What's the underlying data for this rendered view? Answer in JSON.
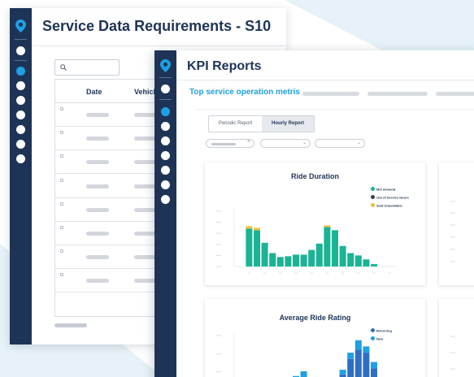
{
  "back_window": {
    "title": "Service Data Requirements - S10",
    "columns": [
      "Date",
      "Vehicle"
    ],
    "row_count": 8
  },
  "front_window": {
    "title": "KPI Reports",
    "section_title": "Top service operation metris",
    "tabs": [
      {
        "label": "Periodic Report",
        "active": false
      },
      {
        "label": "Hourly Report",
        "active": true
      }
    ]
  },
  "sidebar": {
    "active_index": 1
  },
  "charts": {
    "ride_duration": {
      "title": "Ride Duration",
      "legend": [
        {
          "label": "Met demand",
          "color": "#1ab394"
        },
        {
          "label": "Out of Service Hours",
          "color": "#3a4250"
        },
        {
          "label": "Seat Unavailable",
          "color": "#f2c037"
        }
      ]
    },
    "avg_ride_rating": {
      "title": "Average Ride Rating",
      "legend": [
        {
          "label": "Returning",
          "color": "#2e6fc4"
        },
        {
          "label": "New",
          "color": "#1ea0e3"
        }
      ]
    }
  },
  "chart_data": [
    {
      "type": "bar",
      "title": "Ride Duration",
      "categories": [
        "1",
        "2",
        "3",
        "4",
        "5",
        "6",
        "7",
        "8",
        "9",
        "10",
        "11",
        "12",
        "13",
        "14",
        "15",
        "16",
        "17",
        "18",
        "19",
        "20"
      ],
      "series": [
        {
          "name": "Met demand",
          "values": [
            0,
            48,
            46,
            30,
            17,
            12,
            13,
            15,
            15,
            21,
            29,
            50,
            46,
            26,
            17,
            14,
            9,
            3,
            0,
            0
          ]
        },
        {
          "name": "Out of Service Hours",
          "values": [
            0,
            0,
            0,
            0,
            0,
            0,
            0,
            0,
            0,
            0,
            0,
            0,
            0,
            0,
            0,
            0,
            0,
            0,
            0,
            0
          ]
        },
        {
          "name": "Seat Unavailable",
          "values": [
            0,
            3,
            3,
            0,
            0,
            0,
            0,
            0,
            0,
            0,
            0,
            2,
            0,
            0,
            0,
            0,
            0,
            0,
            0,
            0
          ]
        }
      ],
      "stacked": true,
      "ylim": [
        0,
        70
      ]
    },
    {
      "type": "bar",
      "title": "Average Ride Rating",
      "categories": [
        "1",
        "2",
        "3",
        "4",
        "5",
        "6",
        "7",
        "8",
        "9",
        "10",
        "11",
        "12",
        "13",
        "14",
        "15",
        "16",
        "17",
        "18",
        "19",
        "20"
      ],
      "series": [
        {
          "name": "Returning",
          "values": [
            0,
            0,
            0,
            0,
            0,
            0,
            4,
            7,
            8,
            3,
            0,
            0,
            0,
            10,
            20,
            26,
            24,
            14,
            0,
            0
          ]
        },
        {
          "name": "New",
          "values": [
            0,
            0,
            0,
            0,
            0,
            0,
            2,
            2,
            4,
            3,
            0,
            3,
            0,
            3,
            4,
            6,
            4,
            4,
            0,
            0
          ]
        }
      ],
      "stacked": true,
      "ylim": [
        0,
        35
      ]
    }
  ]
}
